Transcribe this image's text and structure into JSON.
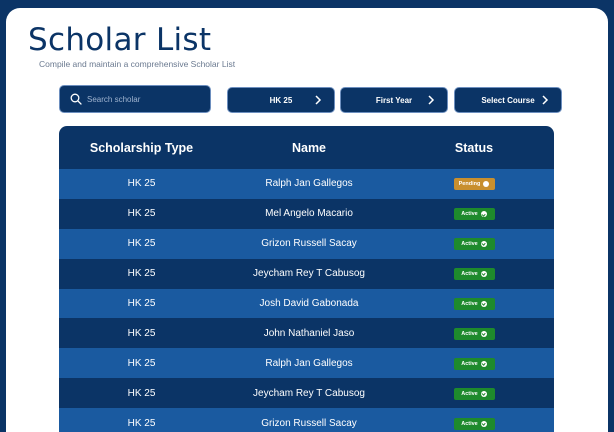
{
  "header": {
    "title": "Scholar List",
    "subtitle": "Compile and maintain a comprehensive Scholar List"
  },
  "search": {
    "placeholder": "Search scholar",
    "icon": "search-icon"
  },
  "filters": [
    {
      "label": "HK 25",
      "icon": "chevron-right-icon"
    },
    {
      "label": "First Year",
      "icon": "chevron-right-icon"
    },
    {
      "label": "Select Course",
      "icon": "chevron-right-icon"
    }
  ],
  "table": {
    "columns": [
      "Scholarship Type",
      "Name",
      "Status"
    ],
    "rows": [
      {
        "type": "HK 25",
        "name": "Ralph Jan Gallegos",
        "status": "Pending"
      },
      {
        "type": "HK 25",
        "name": "Mel Angelo Macario",
        "status": "Active"
      },
      {
        "type": "HK 25",
        "name": "Grizon Russell Sacay",
        "status": "Active"
      },
      {
        "type": "HK 25",
        "name": "Jeycham Rey T Cabusog",
        "status": "Active"
      },
      {
        "type": "HK 25",
        "name": "Josh David Gabonada",
        "status": "Active"
      },
      {
        "type": "HK 25",
        "name": "John Nathaniel Jaso",
        "status": "Active"
      },
      {
        "type": "HK 25",
        "name": "Ralph Jan Gallegos",
        "status": "Active"
      },
      {
        "type": "HK 25",
        "name": "Jeycham Rey T Cabusog",
        "status": "Active"
      },
      {
        "type": "HK 25",
        "name": "Grizon Russell Sacay",
        "status": "Active"
      }
    ]
  },
  "colors": {
    "background": "#0b3466",
    "row_light": "#1a5aa0",
    "row_dark": "#0b3466",
    "active": "#1e8a2c",
    "pending": "#c88f2e"
  }
}
